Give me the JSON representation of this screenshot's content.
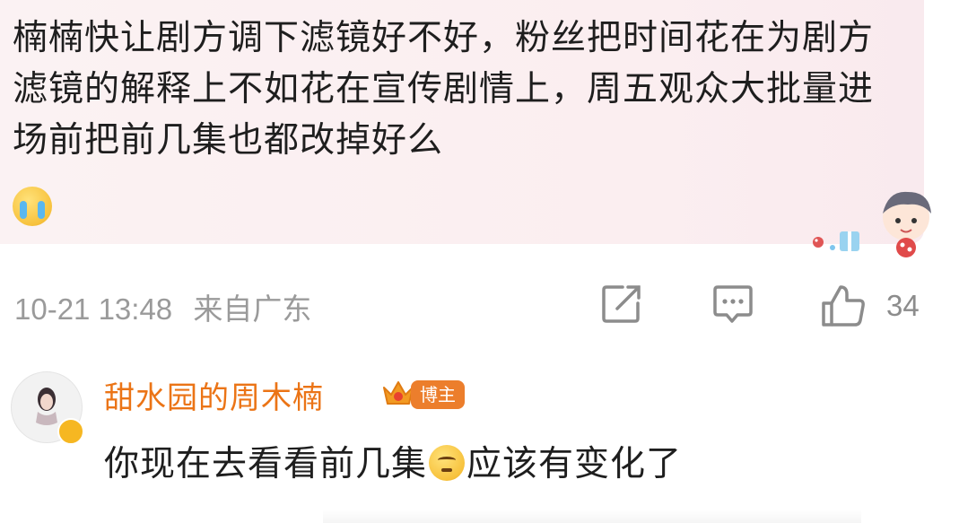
{
  "comment": {
    "text": "楠楠快让剧方调下滤镜好不好，粉丝把时间花在为剧方滤镜的解释上不如花在宣传剧情上，周五观众大批量进场前把前几集也都改掉好么",
    "emoji": "crying-face-emoji",
    "sticker": "cartoon-boy-sticker"
  },
  "meta": {
    "timestamp": "10-21 13:48",
    "location": "来自广东",
    "like_count": "34"
  },
  "reply": {
    "username": "甜水园的周木楠",
    "badge": "博主",
    "text_before": "你现在去看看前几集",
    "text_after": "应该有变化了",
    "emoji": "thinking-face-emoji"
  },
  "colors": {
    "bubble_bg": "#fbf0f2",
    "username": "#eb7416",
    "badge_bg": "#ec7e2c",
    "meta_text": "#9a9a9a"
  },
  "icons": [
    "share-icon",
    "comment-icon",
    "like-icon",
    "crown-icon",
    "verified-icon"
  ]
}
